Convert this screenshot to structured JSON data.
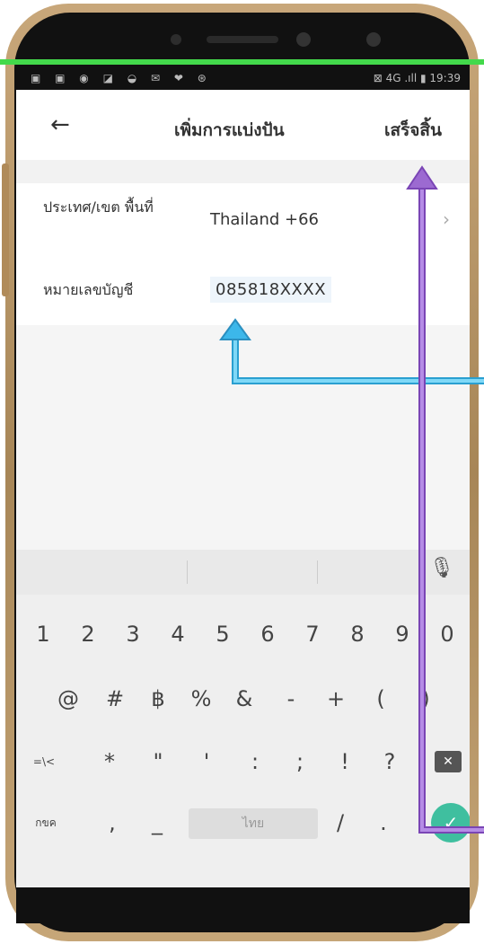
{
  "status": {
    "left_icons": "▣ ▣ ◉ ◪ ◒ ✉ ❤ ⊛",
    "right": "⊠ 4G .ıll ▮ 19:39"
  },
  "header": {
    "title": "เพิ่มการแบ่งปัน",
    "done_label": "เสร็จสิ้น"
  },
  "form": {
    "region_label": "ประเทศ/เขต พื้นที่",
    "region_value": "Thailand +66",
    "account_label": "หมายเลขบัญชี",
    "account_value": "085818XXXX"
  },
  "keyboard": {
    "row1": [
      "1",
      "2",
      "3",
      "4",
      "5",
      "6",
      "7",
      "8",
      "9",
      "0"
    ],
    "row2": [
      "@",
      "#",
      "฿",
      "%",
      "&",
      "-",
      "+",
      "(",
      ")"
    ],
    "row3": [
      "=\\<",
      "*",
      "\"",
      "'",
      ":",
      ";",
      "!",
      "?"
    ],
    "row4": {
      "switch": "กขค",
      "comma": ",",
      "underscore": "_",
      "space": "ไทย",
      "slash": "/",
      "dot": "."
    },
    "delete_icon": "backspace-icon",
    "enter_icon": "check-icon"
  },
  "colors": {
    "phone_frame": "#b08b5a",
    "accent_green": "#43d94b",
    "arrow_blue": "#3cb7ea",
    "arrow_purple": "#9c6ad1",
    "enter_key": "#3fbf9f"
  }
}
